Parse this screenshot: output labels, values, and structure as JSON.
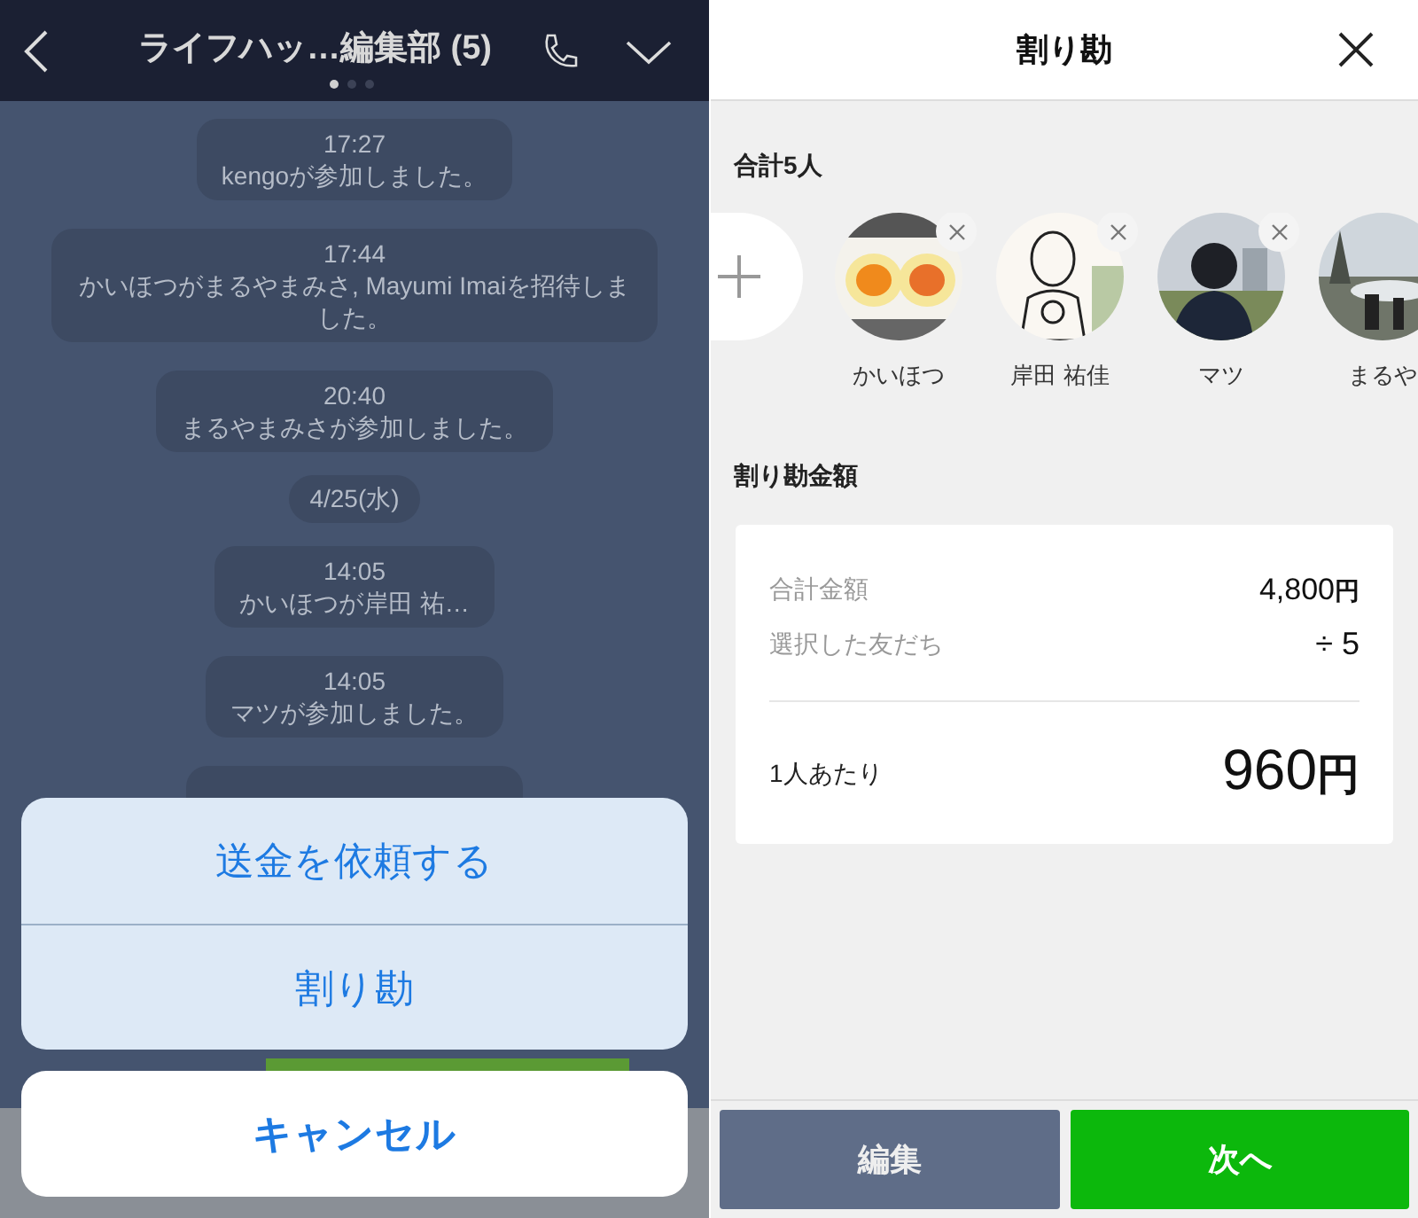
{
  "chat": {
    "title": "ライフハッ…編集部 (5)",
    "pages": [
      {
        "selected": true
      },
      {
        "selected": false
      },
      {
        "selected": false
      }
    ],
    "messages": [
      {
        "kind": "event",
        "time": "17:27",
        "text": "kengoが参加しました。"
      },
      {
        "kind": "event",
        "time": "17:44",
        "text": "かいほつがまるやまみさ, Mayumi Imaiを招待しました。"
      },
      {
        "kind": "event",
        "time": "20:40",
        "text": "まるやまみさが参加しました。"
      },
      {
        "kind": "date",
        "text": "4/25(水)"
      },
      {
        "kind": "event",
        "time": "14:05",
        "text": "かいほつが岸田 祐…"
      },
      {
        "kind": "event",
        "time": "14:05",
        "text": "マツが参加しました。"
      }
    ],
    "action_sheet": {
      "options": [
        "送金を依頼する",
        "割り勘"
      ],
      "cancel": "キャンセル"
    }
  },
  "split": {
    "title": "割り勘",
    "members_label": "合計5人",
    "members": [
      {
        "name": "かいほつ",
        "removable": true,
        "kind": "food"
      },
      {
        "name": "岸田 祐佳",
        "removable": true,
        "kind": "drawing"
      },
      {
        "name": "マツ",
        "removable": true,
        "kind": "person"
      },
      {
        "name": "まるや",
        "removable": false,
        "kind": "park"
      }
    ],
    "amount_label": "割り勘金額",
    "total_label": "合計金額",
    "total": "4,800",
    "total_unit": "円",
    "friends_label": "選択した友だち",
    "divisor": "÷ 5",
    "per_person_label": "1人あたり",
    "per_person": "960",
    "per_person_unit": "円",
    "buttons": [
      {
        "label": "編集",
        "kind": "secondary"
      },
      {
        "label": "次へ",
        "kind": "primary"
      }
    ]
  }
}
